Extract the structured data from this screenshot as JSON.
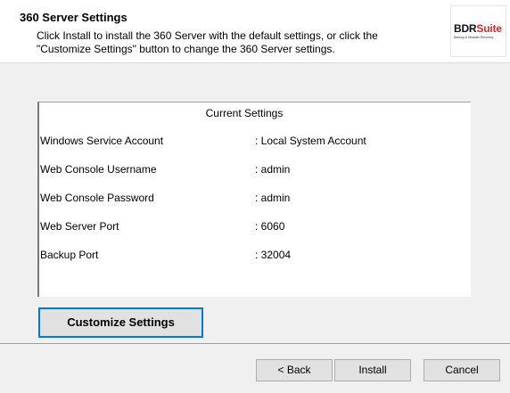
{
  "header": {
    "title": "360 Server Settings",
    "description_line1": "Click Install to install the 360 Server with the default settings, or click the",
    "description_line2": "\"Customize Settings\" button to change the 360 Server settings."
  },
  "logo": {
    "brand_part1": "BDR",
    "brand_part2": "Suite",
    "tagline": "Backup & Disaster Recovery",
    "accent_color": "#d12a2a"
  },
  "settings": {
    "title": "Current Settings",
    "rows": [
      {
        "label": "Windows Service Account",
        "value": ": Local System Account"
      },
      {
        "label": "Web Console Username",
        "value": ": admin"
      },
      {
        "label": "Web Console Password",
        "value": ": admin"
      },
      {
        "label": "Web Server Port",
        "value": ": 6060"
      },
      {
        "label": "Backup Port",
        "value": ": 32004"
      }
    ]
  },
  "buttons": {
    "customize": "Customize Settings",
    "back": "< Back",
    "install": "Install",
    "cancel": "Cancel"
  }
}
